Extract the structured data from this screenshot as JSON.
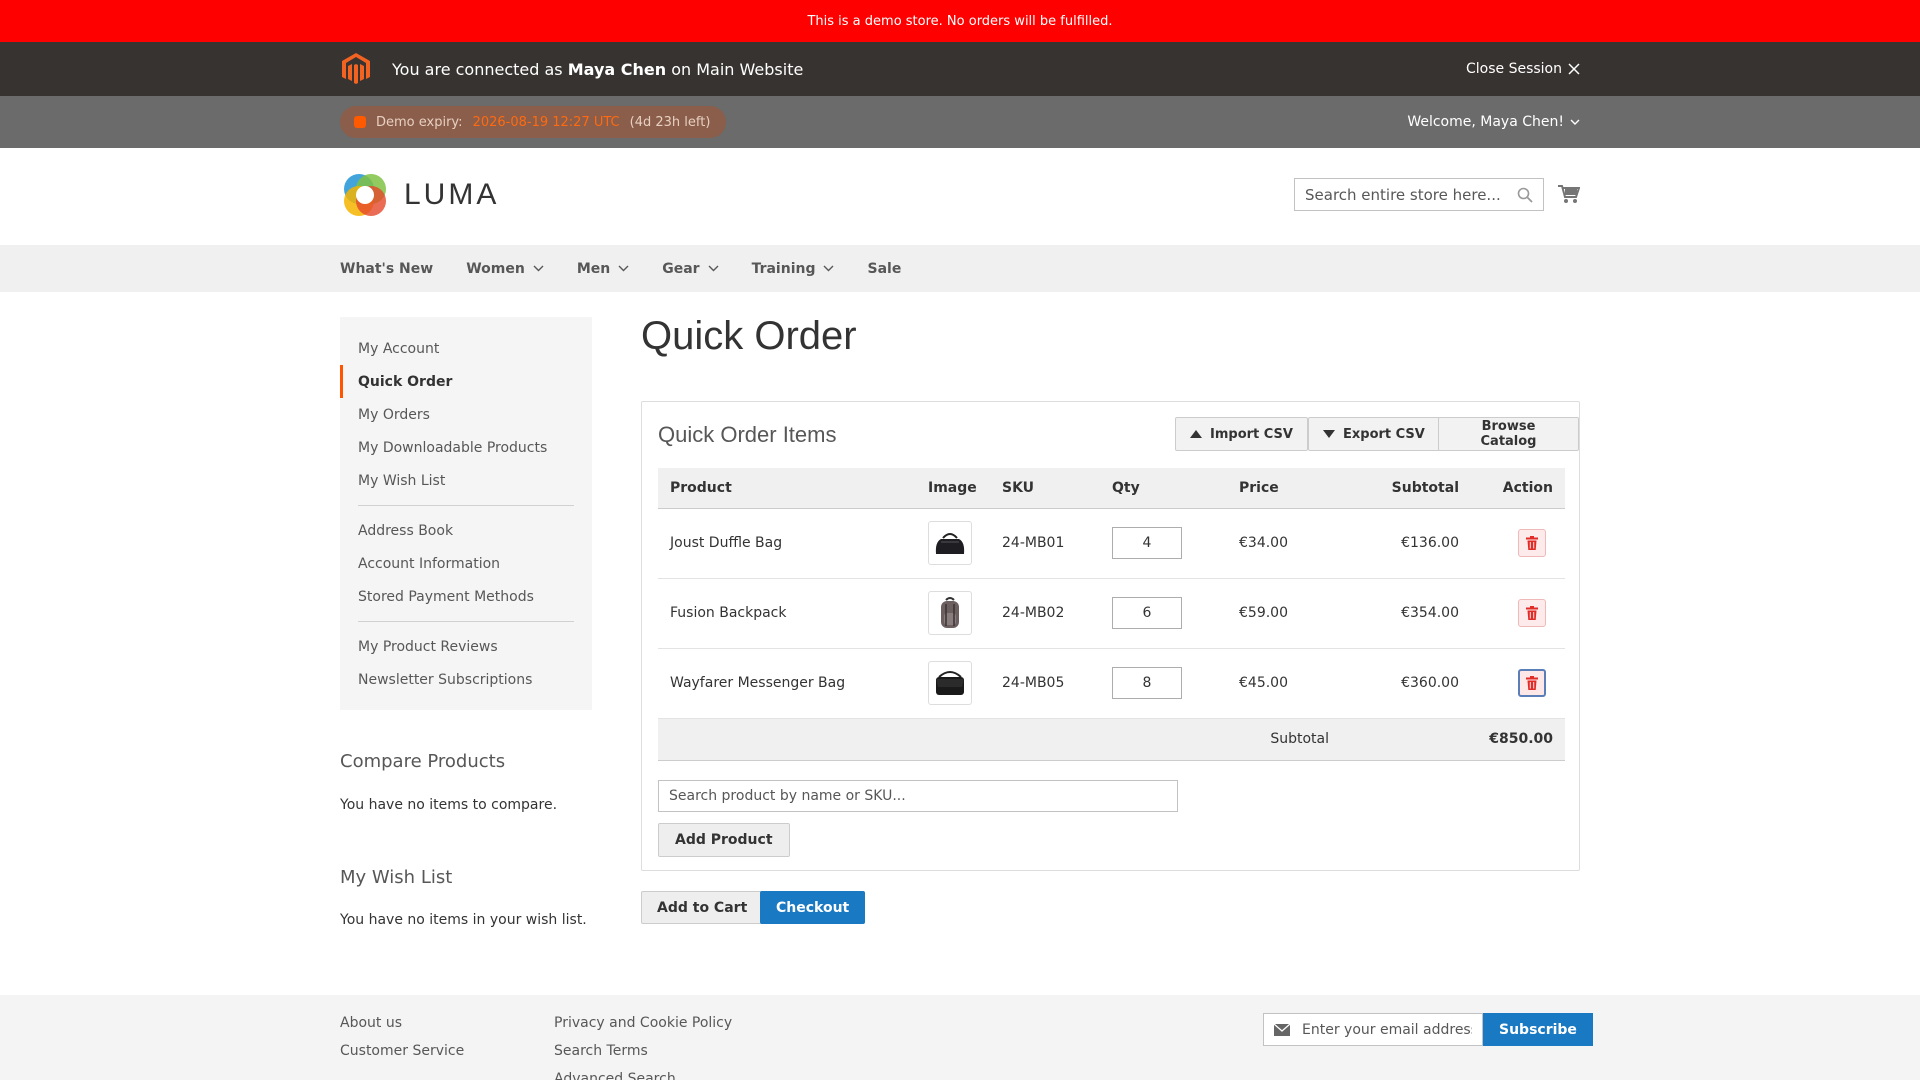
{
  "demo_notice": "This is a demo store. No orders will be fulfilled.",
  "session": {
    "prefix": "You are connected as",
    "user": "Maya Chen",
    "suffix": "on Main Website",
    "close_label": "Close Session"
  },
  "expiry": {
    "label": "Demo expiry:",
    "date": "2026-08-19 12:27 UTC",
    "left": "(4d 23h left)"
  },
  "welcome": "Welcome, Maya Chen!",
  "header": {
    "logo_text": "LUMA",
    "search_placeholder": "Search entire store here..."
  },
  "nav": {
    "items": [
      {
        "label": "What's New",
        "has_menu": false
      },
      {
        "label": "Women",
        "has_menu": true
      },
      {
        "label": "Men",
        "has_menu": true
      },
      {
        "label": "Gear",
        "has_menu": true
      },
      {
        "label": "Training",
        "has_menu": true
      },
      {
        "label": "Sale",
        "has_menu": false
      }
    ]
  },
  "sidebar": {
    "group1": [
      "My Account",
      "Quick Order",
      "My Orders",
      "My Downloadable Products",
      "My Wish List"
    ],
    "group2": [
      "Address Book",
      "Account Information",
      "Stored Payment Methods"
    ],
    "group3": [
      "My Product Reviews",
      "Newsletter Subscriptions"
    ],
    "active": "Quick Order"
  },
  "compare": {
    "title": "Compare Products",
    "text": "You have no items to compare."
  },
  "wishlist": {
    "title": "My Wish List",
    "text": "You have no items in your wish list."
  },
  "main": {
    "title": "Quick Order",
    "box_title": "Quick Order Items",
    "import_label": "Import CSV",
    "export_label": "Export CSV",
    "browse_label": "Browse Catalog",
    "columns": [
      "Product",
      "Image",
      "SKU",
      "Qty",
      "Price",
      "Subtotal",
      "Action"
    ],
    "rows": [
      {
        "product": "Joust Duffle Bag",
        "sku": "24-MB01",
        "qty": "4",
        "price": "€34.00",
        "subtotal": "€136.00",
        "image_icon": "duffle-bag-icon"
      },
      {
        "product": "Fusion Backpack",
        "sku": "24-MB02",
        "qty": "6",
        "price": "€59.00",
        "subtotal": "€354.00",
        "image_icon": "backpack-icon"
      },
      {
        "product": "Wayfarer Messenger Bag",
        "sku": "24-MB05",
        "qty": "8",
        "price": "€45.00",
        "subtotal": "€360.00",
        "image_icon": "messenger-bag-icon"
      }
    ],
    "subtotal_label": "Subtotal",
    "subtotal_value": "€850.00",
    "product_search_placeholder": "Search product by name or SKU...",
    "add_product_label": "Add Product",
    "add_to_cart_label": "Add to Cart",
    "checkout_label": "Checkout"
  },
  "footer": {
    "col1": [
      "About us",
      "Customer Service"
    ],
    "col2": [
      "Privacy and Cookie Policy",
      "Search Terms",
      "Advanced Search"
    ],
    "newsletter_placeholder": "Enter your email address",
    "subscribe_label": "Subscribe"
  },
  "colors": {
    "demo_banner": "#ff0000",
    "accent_orange": "#ff5501",
    "primary_blue": "#1979c3",
    "delete_red": "#e02b27"
  }
}
